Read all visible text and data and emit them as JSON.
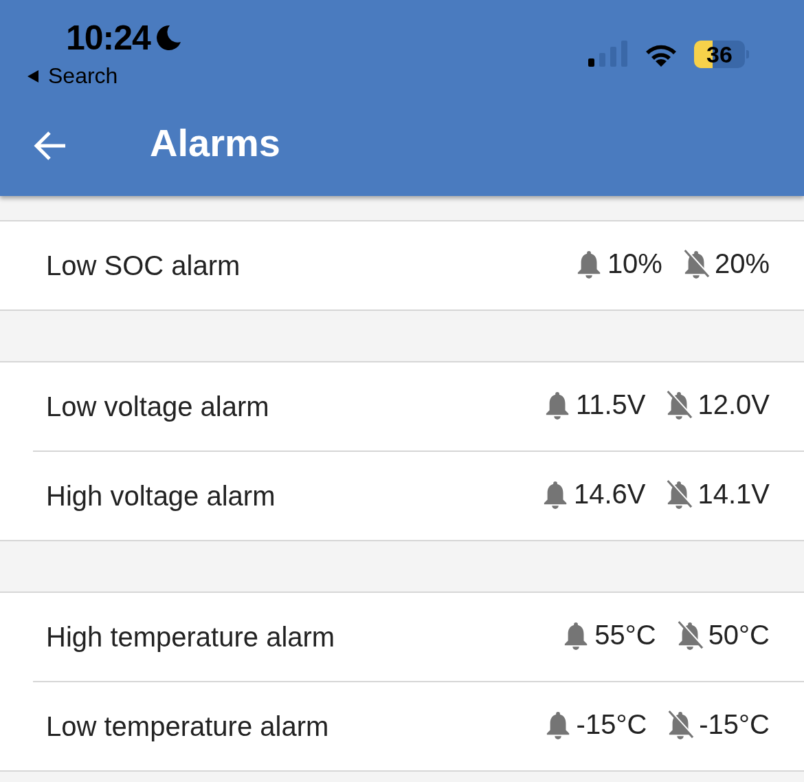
{
  "status_bar": {
    "time": "10:24",
    "back_label": "Search",
    "battery": "36"
  },
  "app_bar": {
    "title": "Alarms"
  },
  "groups": [
    {
      "rows": [
        {
          "label": "Low SOC alarm",
          "alarm": "10%",
          "clear": "20%"
        }
      ]
    },
    {
      "rows": [
        {
          "label": "Low voltage alarm",
          "alarm": "11.5V",
          "clear": "12.0V"
        },
        {
          "label": "High voltage alarm",
          "alarm": "14.6V",
          "clear": "14.1V"
        }
      ]
    },
    {
      "rows": [
        {
          "label": "High temperature alarm",
          "alarm": "55°C",
          "clear": "50°C"
        },
        {
          "label": "Low temperature alarm",
          "alarm": "-15°C",
          "clear": "-15°C"
        }
      ]
    }
  ]
}
